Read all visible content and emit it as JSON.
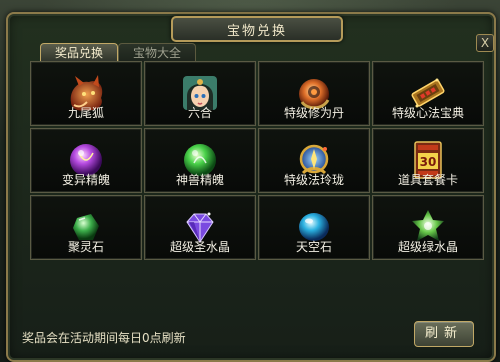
{
  "window": {
    "title": "宝物兑换",
    "close_label": "X"
  },
  "tabs": [
    {
      "label": "奖品兑换",
      "active": true
    },
    {
      "label": "宝物大全",
      "active": false
    }
  ],
  "items": [
    {
      "name": "九尾狐",
      "icon": "fox-icon"
    },
    {
      "name": "六合",
      "icon": "character-icon"
    },
    {
      "name": "特级修为丹",
      "icon": "pill-icon"
    },
    {
      "name": "特级心法宝典",
      "icon": "book-icon"
    },
    {
      "name": "变异精魄",
      "icon": "purple-orb-icon"
    },
    {
      "name": "神兽精魄",
      "icon": "green-orb-icon"
    },
    {
      "name": "特级法玲珑",
      "icon": "artifact-icon"
    },
    {
      "name": "道具套餐卡",
      "icon": "card-icon"
    },
    {
      "name": "聚灵石",
      "icon": "green-stone-icon"
    },
    {
      "name": "超级圣水晶",
      "icon": "purple-crystal-icon"
    },
    {
      "name": "天空石",
      "icon": "blue-stone-icon"
    },
    {
      "name": "超级绿水晶",
      "icon": "green-crystal-icon"
    }
  ],
  "card_number": "30",
  "footer": {
    "note": "奖品会在活动期间每日0点刷新",
    "refresh_label": "刷新"
  }
}
